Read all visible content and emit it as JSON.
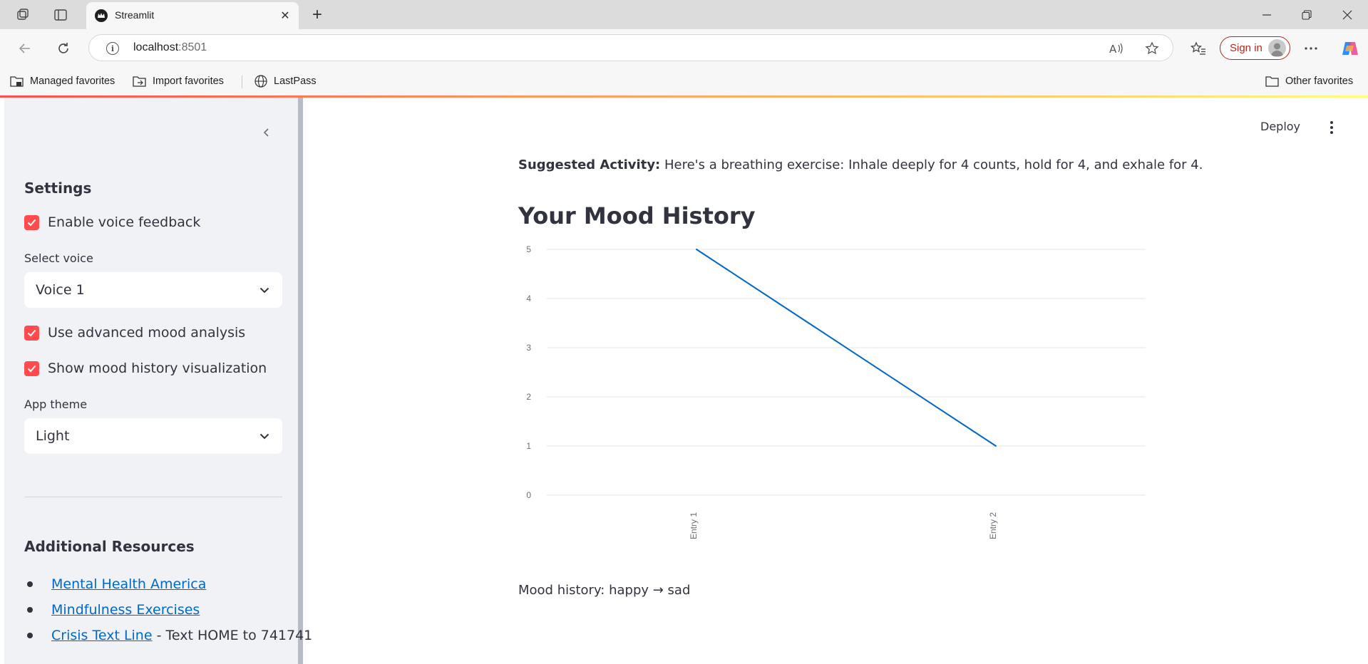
{
  "browser": {
    "tab_title": "Streamlit",
    "url_host": "localhost",
    "url_port": ":8501",
    "sign_in_label": "Sign in",
    "favorites": [
      "Managed favorites",
      "Import favorites",
      "LastPass"
    ],
    "other_favorites": "Other favorites"
  },
  "sidebar": {
    "settings_title": "Settings",
    "enable_voice_label": "Enable voice feedback",
    "enable_voice_checked": true,
    "select_voice_label": "Select voice",
    "select_voice_value": "Voice 1",
    "advanced_mood_label": "Use advanced mood analysis",
    "advanced_mood_checked": true,
    "show_history_label": "Show mood history visualization",
    "show_history_checked": true,
    "app_theme_label": "App theme",
    "app_theme_value": "Light",
    "resources_title": "Additional Resources",
    "resources": [
      {
        "link": "Mental Health America",
        "suffix": ""
      },
      {
        "link": "Mindfulness Exercises",
        "suffix": ""
      },
      {
        "link": "Crisis Text Line",
        "suffix": " - Text HOME to 741741"
      }
    ]
  },
  "main": {
    "deploy_label": "Deploy",
    "activity_prefix": "Suggested Activity:",
    "activity_text": " Here's a breathing exercise: Inhale deeply for 4 counts, hold for 4, and exhale for 4.",
    "history_title": "Your Mood History",
    "mood_history_text": "Mood history: happy → sad"
  },
  "colors": {
    "accent": "#ff4b4b",
    "line": "#0068c9",
    "link": "#0068c9",
    "sidebar_bg": "#f0f2f6"
  },
  "chart_data": {
    "type": "line",
    "categories": [
      "Entry 1",
      "Entry 2"
    ],
    "series": [
      {
        "values": [
          5,
          1
        ]
      }
    ],
    "yticks": [
      0,
      1,
      2,
      3,
      4,
      5
    ],
    "ylim": [
      0,
      5
    ],
    "grid": true,
    "title": "",
    "xlabel": "",
    "ylabel": ""
  }
}
